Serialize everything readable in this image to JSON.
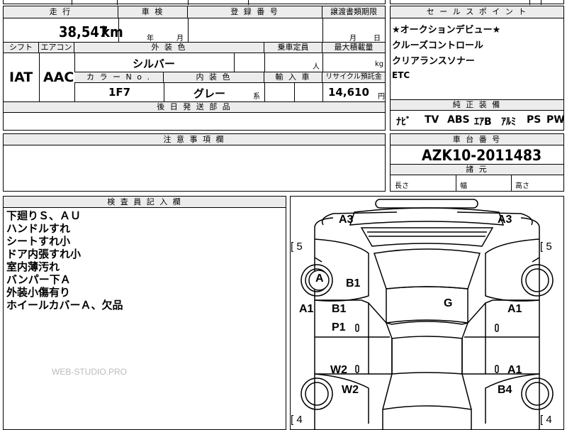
{
  "top_hints": {
    "h1": "",
    "h2": ""
  },
  "main": {
    "mileage_label": "走 行",
    "mileage_value": "38,547",
    "mileage_unit": "km",
    "inspection_label": "車 検",
    "inspection_year": "年",
    "inspection_month": "月",
    "registration_label": "登 録 番 号",
    "transfer_label": "譲渡書類期限",
    "transfer_month": "月",
    "transfer_day": "日",
    "shift_label": "シフト",
    "aircon_label": "エアコン",
    "exterior_label": "外 装 色",
    "capacity_label": "乗車定員",
    "load_label": "最大積載量",
    "shift_value": "IAT",
    "aircon_value": "AAC",
    "exterior_value": "シルバー",
    "capacity_unit": "人",
    "load_unit": "kg",
    "color_no_label": "カ ラ ー N o .",
    "interior_label": "内 装 色",
    "import_label": "輸 入 車",
    "recycle_label": "リサイクル預託金",
    "color_no_value": "1F7",
    "interior_value": "グレー",
    "interior_suffix": "系",
    "recycle_value": "14,610",
    "recycle_unit": "円",
    "later_parts_label": "後 日 発 送 部 品"
  },
  "sales": {
    "label": "セ ー ル ス ポ イ ン ト",
    "lines": [
      "★オークションデビュー★",
      "クルーズコントロール",
      "クリアランスソナー",
      "ETC"
    ]
  },
  "equipment": {
    "label": "純 正 装 備",
    "items": [
      "ﾅﾋﾞ",
      "TV",
      "ABS",
      "ｴｱB",
      "ｱﾙﾐ",
      "PS",
      "PW"
    ]
  },
  "caution": {
    "label": "注 意 事 項 欄"
  },
  "chassis": {
    "label": "車 台 番 号",
    "value": "AZK10-2011483",
    "dims_label": "諸 元",
    "length_label": "長さ",
    "width_label": "幅",
    "height_label": "高さ"
  },
  "inspector": {
    "label": "検 査 員 記 入 欄",
    "notes": [
      "下廻りＳ、ＡＵ",
      "ハンドルすれ",
      "シートすれ小",
      "ドア内張すれ小",
      "室内薄汚れ",
      "バンパー下Ａ",
      "外装小傷有り",
      "ホイールカバーＡ、欠品"
    ],
    "watermark": "WEB-STUDIO.PRO"
  },
  "diagram": {
    "codes": {
      "a3_left": "A3",
      "a3_right": "A3",
      "tire_fl": "5",
      "tire_fr": "5",
      "tire_rl": "4",
      "tire_rr": "4",
      "wheel_a": "A",
      "b1_top": "B1",
      "g": "G",
      "a1_left": "A1",
      "a1_right": "A1",
      "b1_mid": "B1",
      "p1": "P1",
      "w2_door": "W2",
      "a1_rdoor": "A1",
      "w2_rear": "W2",
      "b4": "B4"
    }
  }
}
